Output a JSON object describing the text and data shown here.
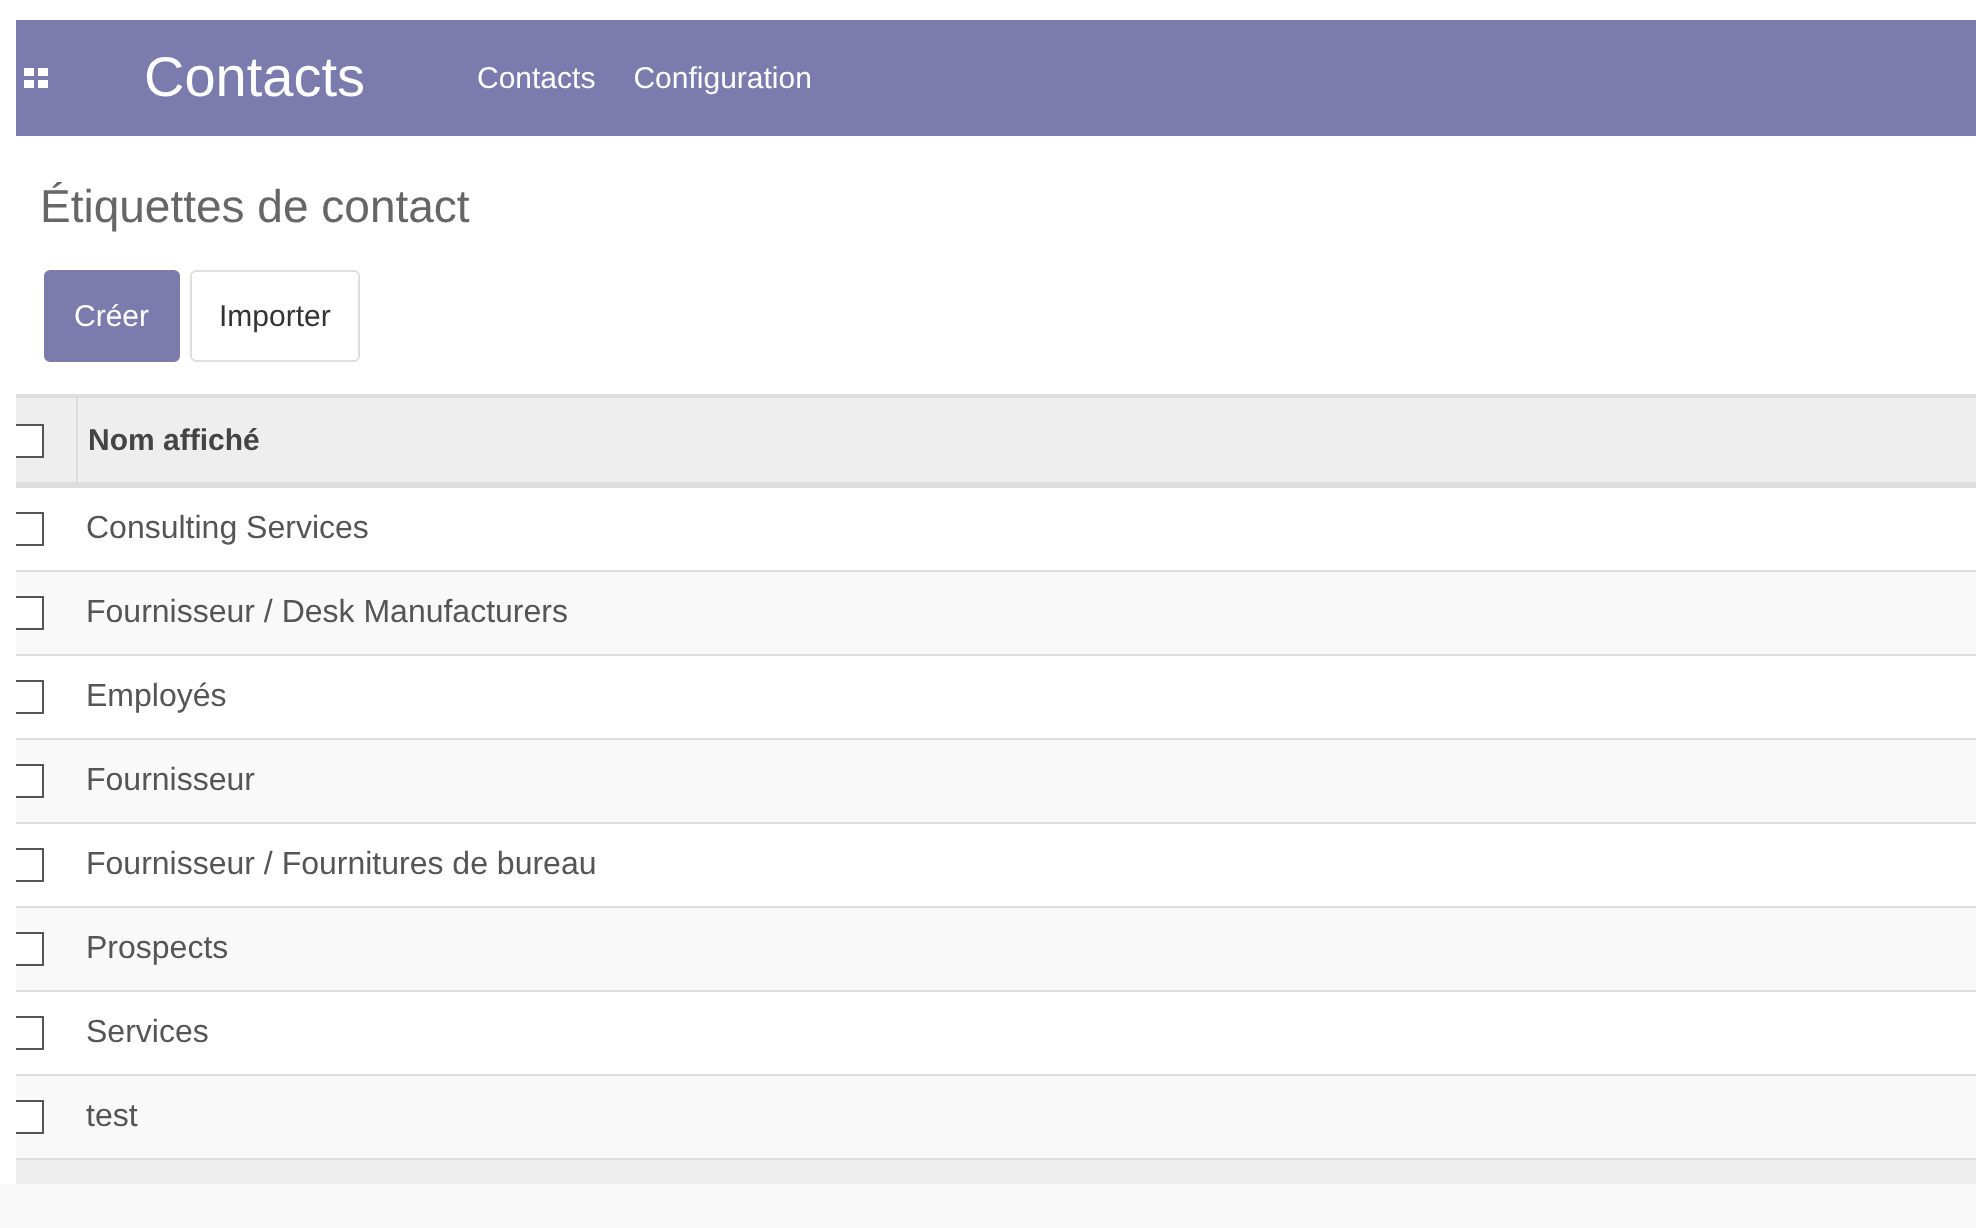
{
  "navbar": {
    "app_title": "Contacts",
    "menu": [
      {
        "label": "Contacts"
      },
      {
        "label": "Configuration"
      }
    ]
  },
  "page_title": "Étiquettes de contact",
  "buttons": [
    {
      "label": "Créer",
      "kind": "primary"
    },
    {
      "label": "Importer",
      "kind": "secondary"
    }
  ],
  "table": {
    "select_all_checked": false,
    "columns": [
      "Nom affiché"
    ],
    "rows": [
      {
        "name": "Consulting Services",
        "checked": false
      },
      {
        "name": "Fournisseur / Desk Manufacturers",
        "checked": false
      },
      {
        "name": "Employés",
        "checked": false
      },
      {
        "name": "Fournisseur",
        "checked": false
      },
      {
        "name": "Fournisseur / Fournitures de bureau",
        "checked": false
      },
      {
        "name": "Prospects",
        "checked": false
      },
      {
        "name": "Services",
        "checked": false
      },
      {
        "name": "test",
        "checked": false
      }
    ]
  }
}
